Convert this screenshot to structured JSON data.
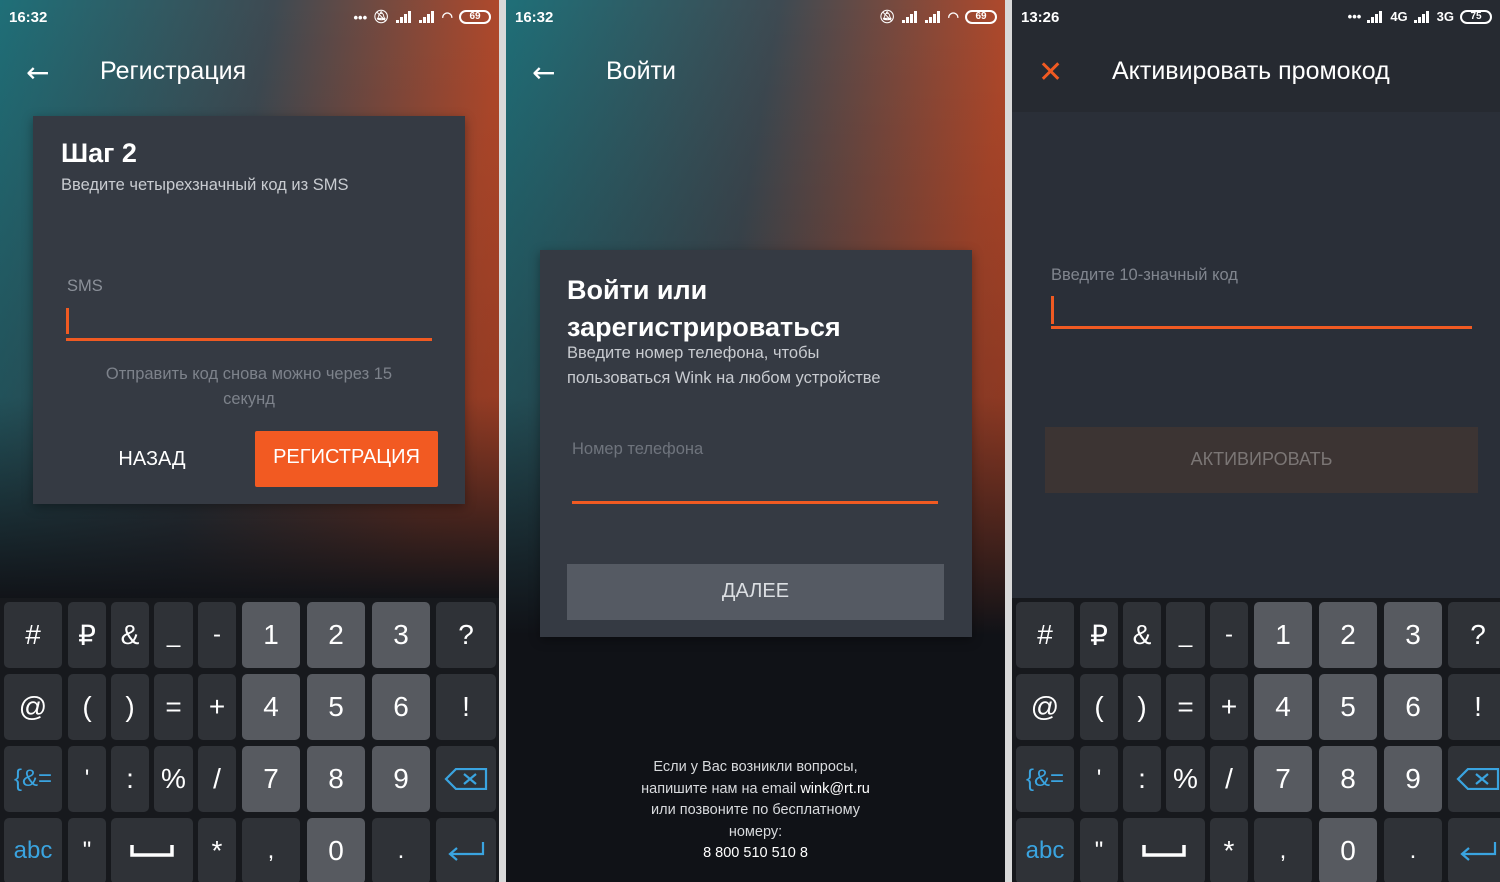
{
  "colors": {
    "accent": "#f05a22",
    "card": "#353a43",
    "key_symbol": "#2f3237",
    "key_number": "#575a60",
    "keyboard_bg": "#17191d",
    "fn_key": "#3aa4e0"
  },
  "screens": [
    {
      "status": {
        "time": "16:32",
        "battery": "69"
      },
      "appbar": {
        "nav_icon": "back-arrow-icon",
        "title": "Регистрация"
      },
      "card": {
        "heading": "Шаг 2",
        "subtitle": "Введите четырехзначный код из SMS",
        "field_placeholder": "SMS",
        "resend_note_line1": "Отправить код снова можно через 15",
        "resend_note_line2": "секунд",
        "back_button": "НАЗАД",
        "register_button": "РЕГИСТРАЦИЯ"
      }
    },
    {
      "status": {
        "time": "16:32",
        "battery": "69"
      },
      "appbar": {
        "nav_icon": "back-arrow-icon",
        "title": "Войти"
      },
      "card": {
        "heading_line1": "Войти или",
        "heading_line2": "зарегистрироваться",
        "subtitle_line1": "Введите номер телефона, чтобы",
        "subtitle_line2": "пользоваться Wink на любом устройстве",
        "field_placeholder": "Номер телефона",
        "next_button": "ДАЛЕЕ"
      },
      "help": {
        "line1": "Если у Вас возникли вопросы,",
        "line2_prefix": "напишите нам на email ",
        "email": "wink@rt.ru",
        "line3": "или позвоните по бесплатному",
        "line4": "номеру:",
        "phone": "8 800 510 510 8"
      }
    },
    {
      "status": {
        "time": "13:26",
        "network1": "4G",
        "network2": "3G",
        "battery": "75"
      },
      "appbar": {
        "nav_icon": "close-icon",
        "title": "Активировать промокод"
      },
      "form": {
        "field_placeholder": "Введите 10-значный код",
        "activate_button": "АКТИВИРОВАТЬ"
      }
    }
  ],
  "keyboard": {
    "rows": [
      [
        "#",
        "₽",
        "&",
        "_",
        "-",
        "1",
        "2",
        "3",
        "?"
      ],
      [
        "@",
        "(",
        ")",
        "=",
        "+",
        "4",
        "5",
        "6",
        "!"
      ],
      [
        "{&=",
        "'",
        ":",
        "%",
        "/",
        "7",
        "8",
        "9",
        "⌫"
      ],
      [
        "abc",
        "\"",
        "␣",
        "*",
        ",",
        "0",
        ".",
        "↵"
      ]
    ]
  }
}
